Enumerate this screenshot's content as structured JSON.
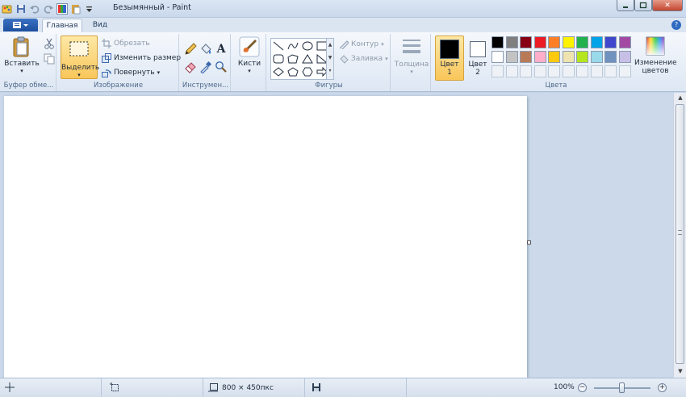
{
  "window": {
    "title": "Безымянный - Paint"
  },
  "tabs": [
    {
      "label": "Главная",
      "active": true
    },
    {
      "label": "Вид",
      "active": false
    }
  ],
  "clipboard": {
    "paste_label": "Вставить",
    "group_label": "Буфер обме..."
  },
  "image": {
    "select_label": "Выделить",
    "crop_label": "Обрезать",
    "resize_label": "Изменить размер",
    "rotate_label": "Повернуть",
    "group_label": "Изображение"
  },
  "tools": {
    "group_label": "Инструмен..."
  },
  "brushes": {
    "label": "Кисти"
  },
  "shapes": {
    "outline_label": "Контур",
    "fill_label": "Заливка",
    "group_label": "Фигуры"
  },
  "size": {
    "label": "Толщина"
  },
  "colors": {
    "color1_label_line1": "Цвет",
    "color1_label_line2": "1",
    "color2_label_line1": "Цвет",
    "color2_label_line2": "2",
    "edit_label_line1": "Изменение",
    "edit_label_line2": "цветов",
    "group_label": "Цвета",
    "color1": "#000000",
    "color2": "#ffffff",
    "palette_row1": [
      "#000000",
      "#7f7f7f",
      "#880015",
      "#ed1c24",
      "#ff7f27",
      "#fff200",
      "#22b14c",
      "#00a2e8",
      "#3f48cc",
      "#a349a4"
    ],
    "palette_row2": [
      "#ffffff",
      "#c3c3c3",
      "#b97a57",
      "#ffaec9",
      "#ffc90e",
      "#efe4b0",
      "#b5e61d",
      "#99d9ea",
      "#7092be",
      "#c8bfe7"
    ],
    "palette_row3": [
      "#eef2f7",
      "#eef2f7",
      "#eef2f7",
      "#eef2f7",
      "#eef2f7",
      "#eef2f7",
      "#eef2f7",
      "#eef2f7",
      "#eef2f7",
      "#eef2f7"
    ]
  },
  "status": {
    "canvas_size": "800 × 450пкс",
    "zoom": "100%",
    "zoom_level": 1.0
  }
}
